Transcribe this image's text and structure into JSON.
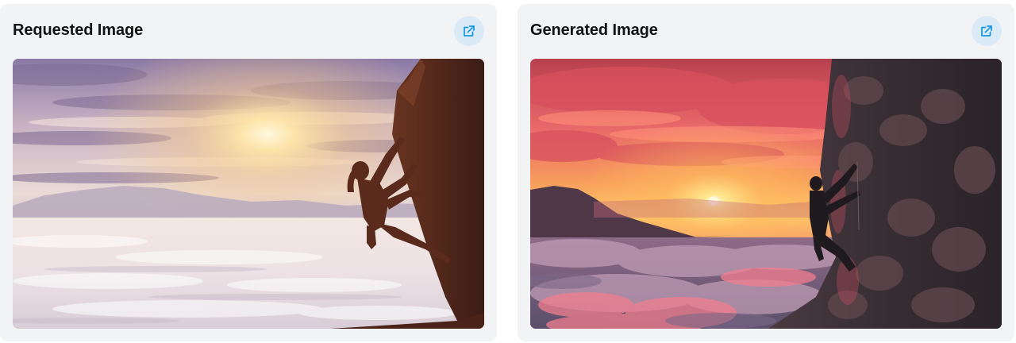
{
  "panels": [
    {
      "title": "Requested Image",
      "button_icon": "external-link-icon"
    },
    {
      "title": "Generated Image",
      "button_icon": "external-link-icon"
    }
  ],
  "colors": {
    "card_bg": "#f2f3f5",
    "button_bg": "#dbeaf7",
    "button_icon": "#1a9ae0",
    "title_text": "#121212"
  }
}
